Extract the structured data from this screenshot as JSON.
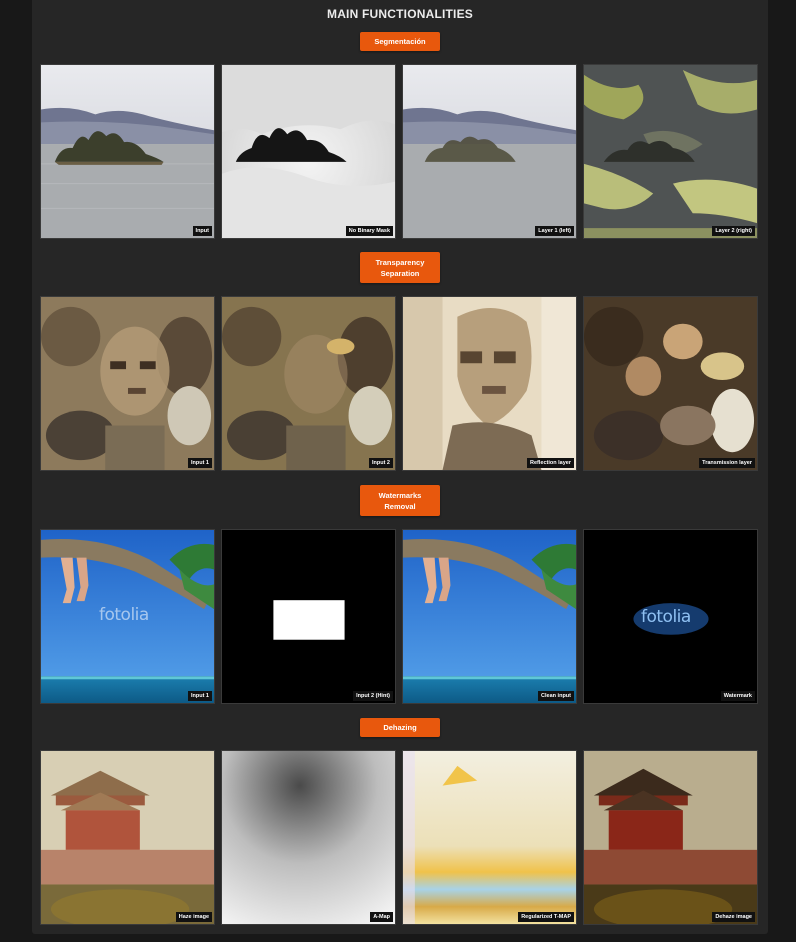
{
  "title": "MAIN FUNCTIONALITIES",
  "sections": [
    {
      "button": "Segmentación",
      "captions": [
        "Input",
        "No Binary Mask",
        "Layer 1 (left)",
        "Layer 2 (right)"
      ]
    },
    {
      "button": "Transparency\nSeparation",
      "captions": [
        "Input 1",
        "Input 2",
        "Reflection layer",
        "Transmission layer"
      ]
    },
    {
      "button": "Watermarks\nRemoval",
      "captions": [
        "Input 1",
        "Input 2 (Hint)",
        "Clean input",
        "Watermark"
      ]
    },
    {
      "button": "Dehazing",
      "captions": [
        "Haze image",
        "A-Map",
        "Regularized T-MAP",
        "Dehaze image"
      ]
    }
  ],
  "watermark_text": "fotolia",
  "colors": {
    "accent": "#e8580d",
    "panel": "#262626",
    "background": "#181818"
  }
}
